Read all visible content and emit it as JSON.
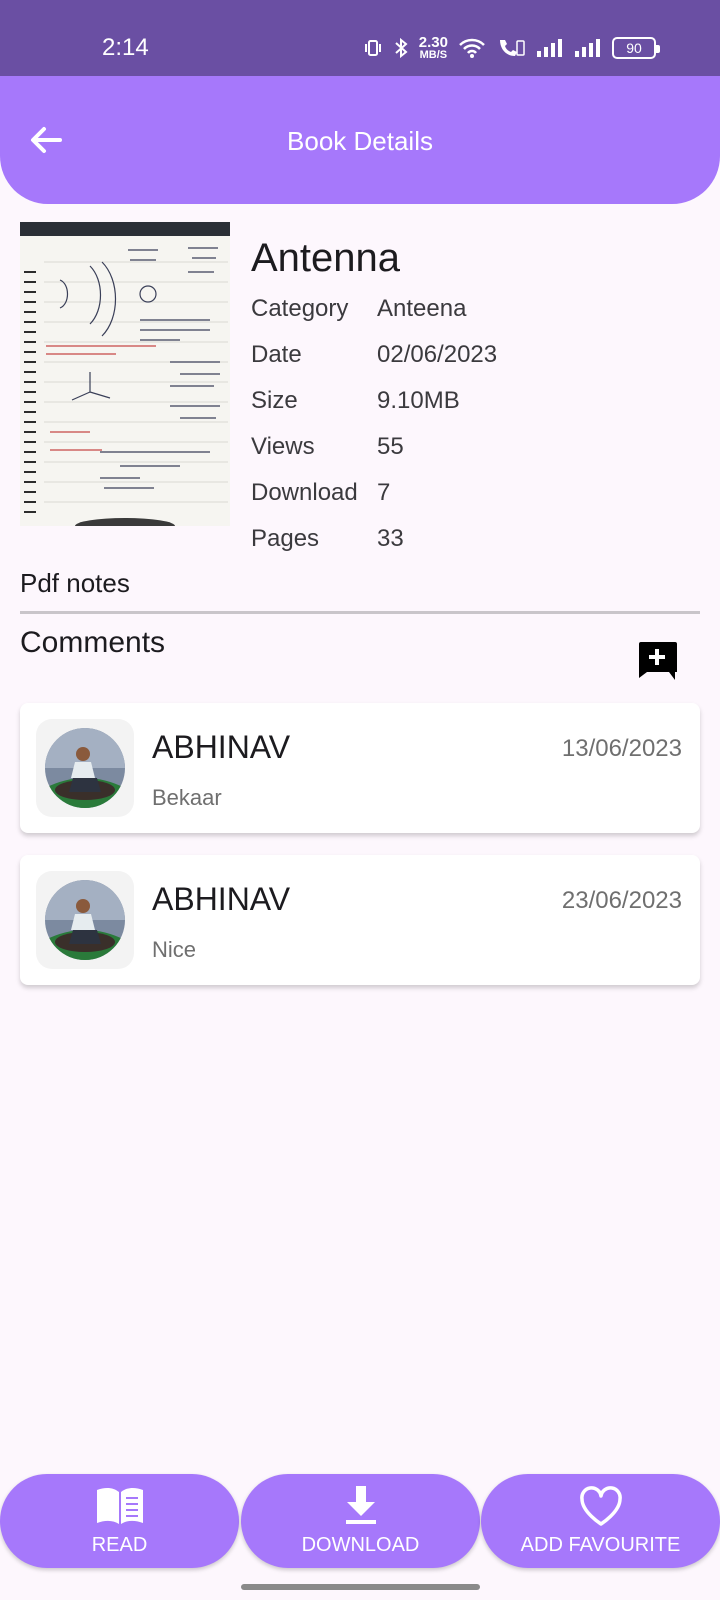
{
  "status_bar": {
    "time": "2:14",
    "net_speed_value": "2.30",
    "net_speed_unit": "MB/S",
    "battery": "90"
  },
  "app_bar": {
    "title": "Book Details"
  },
  "book": {
    "title": "Antenna",
    "details": [
      {
        "label": "Category",
        "value": "Anteena"
      },
      {
        "label": "Date",
        "value": "02/06/2023"
      },
      {
        "label": "Size",
        "value": "9.10MB"
      },
      {
        "label": "Views",
        "value": "55"
      },
      {
        "label": "Download",
        "value": "7"
      },
      {
        "label": "Pages",
        "value": "33"
      }
    ]
  },
  "sections": {
    "pdf_notes": "Pdf notes",
    "comments": "Comments"
  },
  "comments": [
    {
      "name": "ABHINAV",
      "text": "Bekaar",
      "date": "13/06/2023"
    },
    {
      "name": "ABHINAV",
      "text": "Nice",
      "date": "23/06/2023"
    }
  ],
  "actions": {
    "read": "READ",
    "download": "DOWNLOAD",
    "favourite": "ADD FAVOURITE"
  },
  "colors": {
    "status_bar": "#6A4FA3",
    "accent": "#A678FB",
    "background": "#FDF7FD"
  },
  "icons": {
    "back": "arrow-left-icon",
    "add_comment": "add-comment-icon",
    "read": "open-book-icon",
    "download": "download-icon",
    "favourite": "heart-icon"
  }
}
